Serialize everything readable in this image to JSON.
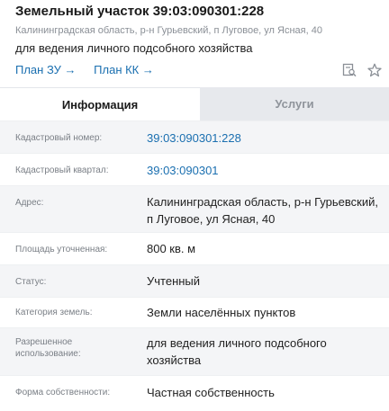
{
  "header": {
    "title": "Земельный участок 39:03:090301:228",
    "address": "Калининградская область, р-н Гурьевский, п Луговое, ул Ясная, 40",
    "purpose": "для ведения личного подсобного хозяйства",
    "links": {
      "plan_zu": "План ЗУ →",
      "plan_kk": "План КК →"
    },
    "icons": [
      "search-document-icon",
      "star-icon"
    ]
  },
  "tabs": {
    "info": "Информация",
    "services": "Услуги"
  },
  "rows": [
    {
      "label": "Кадастровый номер:",
      "value": "39:03:090301:228"
    },
    {
      "label": "Кадастровый квартал:",
      "value": "39:03:090301"
    },
    {
      "label": "Адрес:",
      "value": "Калининградская область, р-н Гурьевский, п Луговое, ул Ясная, 40"
    },
    {
      "label": "Площадь уточненная:",
      "value": "800 кв. м"
    },
    {
      "label": "Статус:",
      "value": "Учтенный"
    },
    {
      "label": "Категория земель:",
      "value": "Земли населённых пунктов"
    },
    {
      "label": "Разрешенное использование:",
      "value": "для ведения личного подсобного хозяйства"
    },
    {
      "label": "Форма собственности:",
      "value": "Частная собственность"
    }
  ],
  "colors": {
    "link": "#1a6fb0",
    "stripe": "#f4f5f7",
    "inactive_tab": "#e7e9ed"
  }
}
